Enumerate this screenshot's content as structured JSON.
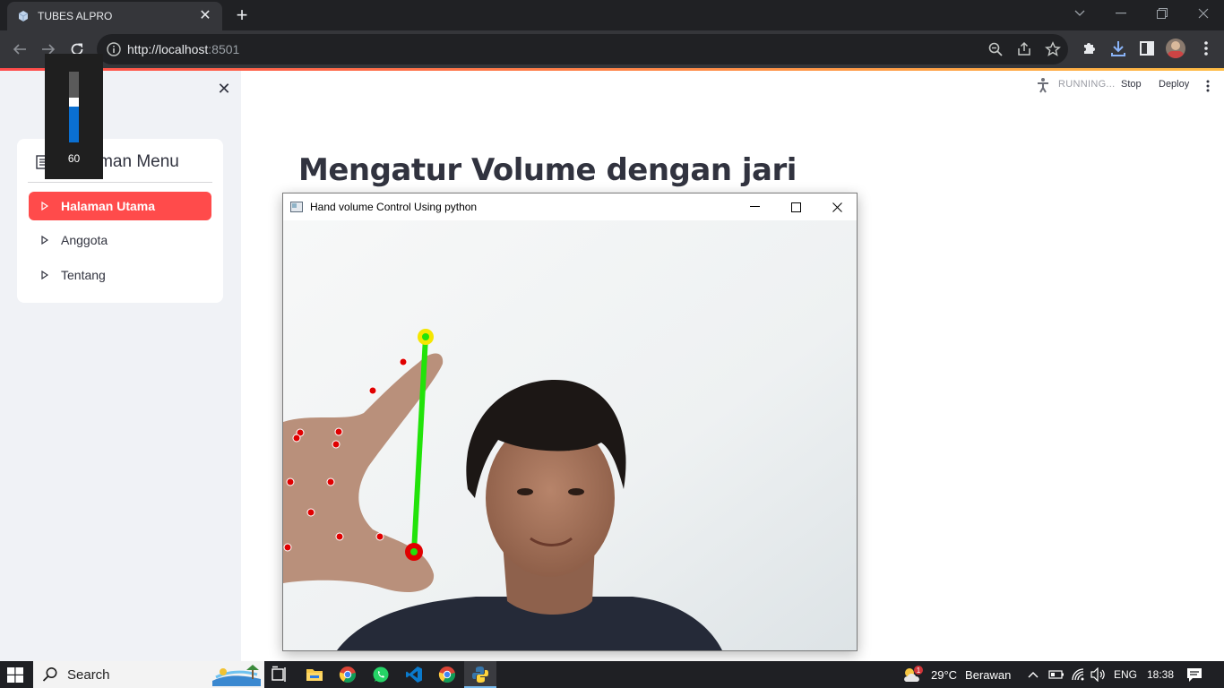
{
  "browser": {
    "tab_title": "TUBES ALPRO",
    "url_host": "http://localhost",
    "url_port": ":8501"
  },
  "sidebar": {
    "menu_title": "Halaman Menu",
    "items": [
      {
        "label": "Halaman Utama",
        "active": true
      },
      {
        "label": "Anggota",
        "active": false
      },
      {
        "label": "Tentang",
        "active": false
      }
    ]
  },
  "header": {
    "status": "RUNNING...",
    "stop": "Stop",
    "deploy": "Deploy"
  },
  "main": {
    "title": "Mengatur Volume dengan jari"
  },
  "cv_window": {
    "title": "Hand volume Control Using python"
  },
  "volume": {
    "value": "60",
    "level": 0.5
  },
  "colors": {
    "accent": "#ff4b4b",
    "volume_fill": "#0a6fd1",
    "line": "#22e30a",
    "landmark": "#e00000",
    "fingertip": "#f5e600"
  },
  "taskbar": {
    "search_label": "Search",
    "weather": "29°C",
    "weather_desc": "Berawan",
    "language": "ENG",
    "time": "18:38",
    "notif_badge": "1"
  }
}
